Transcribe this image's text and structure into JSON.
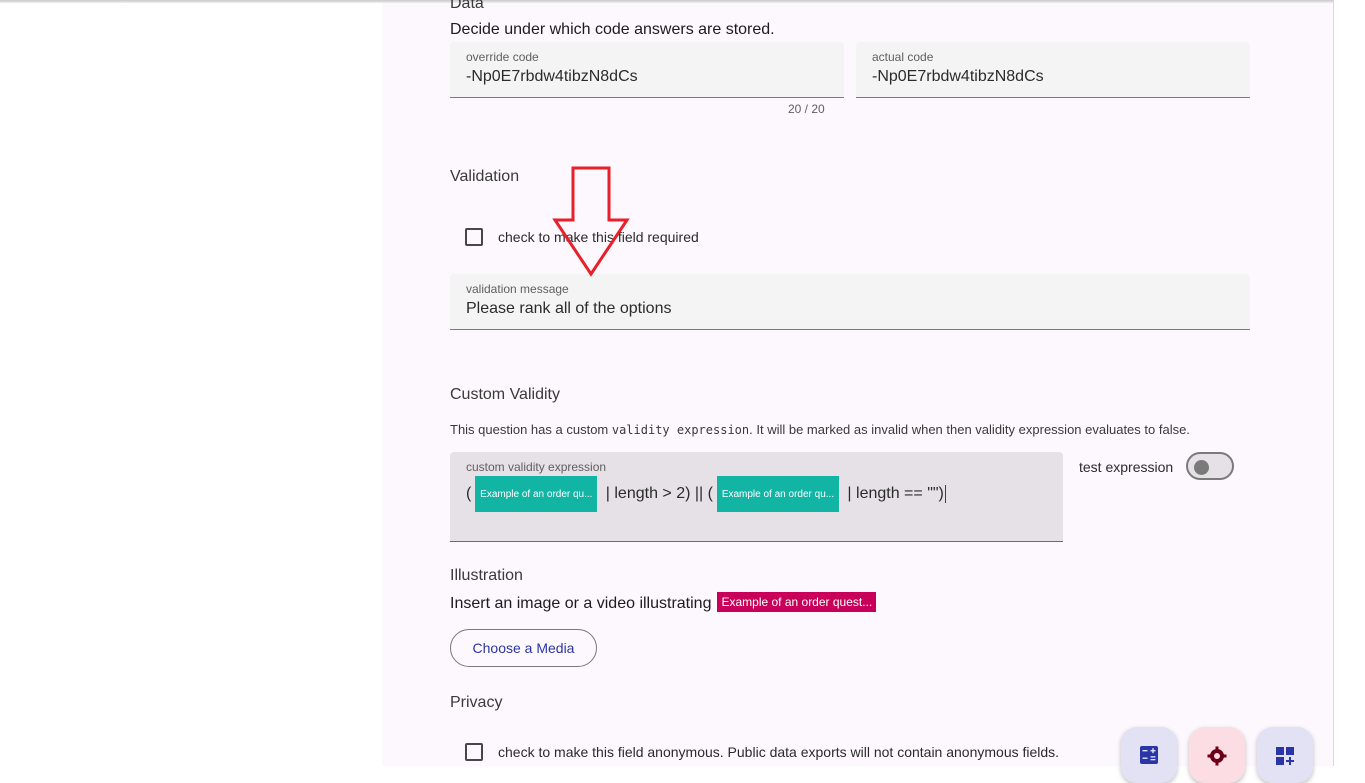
{
  "data_section": {
    "title": "Data",
    "description": "Decide under which code answers are stored.",
    "override_code": {
      "label": "override code",
      "value": "-Np0E7rbdw4tibzN8dCs",
      "counter": "20 / 20"
    },
    "actual_code": {
      "label": "actual code",
      "value": "-Np0E7rbdw4tibzN8dCs"
    }
  },
  "validation": {
    "title": "Validation",
    "required_checkbox_label": "check to make this field required",
    "required_checked": false,
    "message_label": "validation message",
    "message_value": "Please rank all of the options"
  },
  "custom_validity": {
    "title": "Custom Validity",
    "description_before": "This question has a custom ",
    "description_code": "validity expression",
    "description_after": ". It will be marked as invalid when then validity expression evaluates to false.",
    "expression_label": "custom validity expression",
    "expr_part_1": "(",
    "chip_1": "Example of an order qu...",
    "expr_part_2": " | length > 2) || (",
    "chip_2": "Example of an order qu...",
    "expr_part_3": " | length == \"\")",
    "test_expression_label": "test expression",
    "test_expression_on": false
  },
  "illustration": {
    "title": "Illustration",
    "description": "Insert an image or a video illustrating",
    "chip": "Example of an order quest...",
    "button_label": "Choose a Media"
  },
  "privacy": {
    "title": "Privacy",
    "anonymous_checkbox_label": "check to make this field anonymous. Public data exports will not contain anonymous fields.",
    "anonymous_checked": false
  },
  "fabs": [
    "calculator-icon",
    "gear-icon",
    "add-widget-icon"
  ],
  "colors": {
    "chip_teal": "#12b5a4",
    "chip_pink": "#c8005a",
    "annotation_arrow": "#e8202a",
    "primary_text": "#2a35a8"
  }
}
